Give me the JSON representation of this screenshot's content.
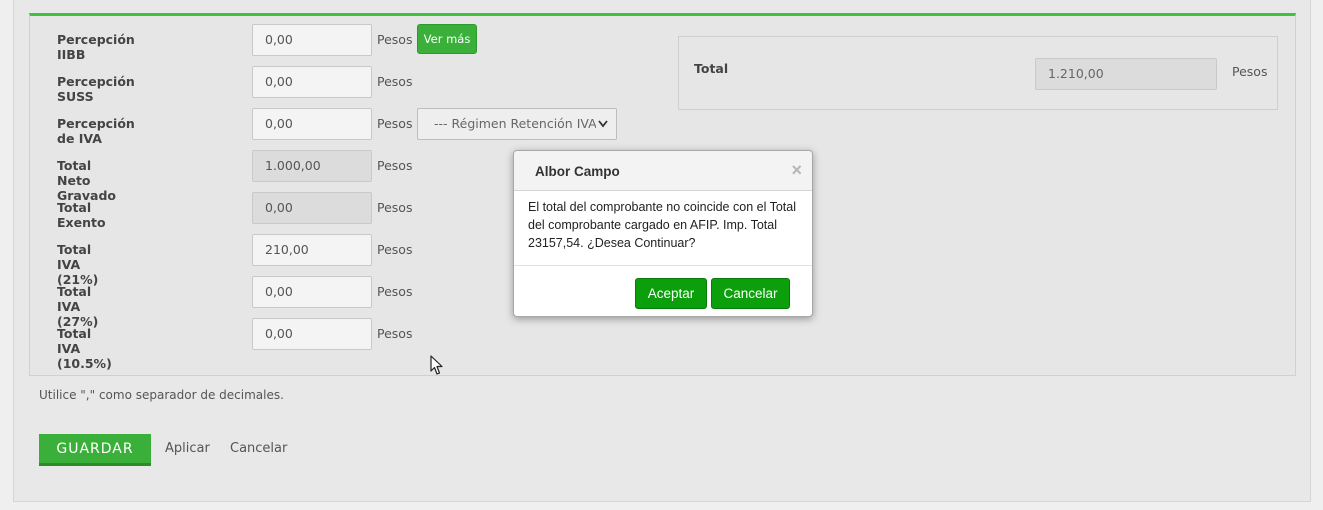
{
  "fields": [
    {
      "label": "Percepción IIBB",
      "value": "0,00",
      "unit": "Pesos",
      "readonly": false
    },
    {
      "label": "Percepción SUSS",
      "value": "0,00",
      "unit": "Pesos",
      "readonly": false
    },
    {
      "label": "Percepción de IVA",
      "value": "0,00",
      "unit": "Pesos",
      "readonly": false
    },
    {
      "label": "Total Neto Gravado",
      "value": "1.000,00",
      "unit": "Pesos",
      "readonly": true
    },
    {
      "label": "Total Exento",
      "value": "0,00",
      "unit": "Pesos",
      "readonly": true
    },
    {
      "label": "Total IVA (21%)",
      "value": "210,00",
      "unit": "Pesos",
      "readonly": false
    },
    {
      "label": "Total IVA (27%)",
      "value": "0,00",
      "unit": "Pesos",
      "readonly": false
    },
    {
      "label": "Total IVA (10.5%)",
      "value": "0,00",
      "unit": "Pesos",
      "readonly": false
    }
  ],
  "ver_mas_label": "Ver más",
  "regimen_select": {
    "selected": "--- Régimen Retención IVA"
  },
  "total": {
    "label": "Total",
    "value": "1.210,00",
    "unit": "Pesos"
  },
  "hint": "Utilice \",\" como separador de decimales.",
  "actions": {
    "guardar": "GUARDAR",
    "aplicar": "Aplicar",
    "cancelar": "Cancelar"
  },
  "dialog": {
    "title": "Albor Campo",
    "close": "×",
    "message": "El total del comprobante no coincide con el Total del comprobante cargado en AFIP. Imp. Total 23157,54. ¿Desea Continuar?",
    "accept": "Aceptar",
    "cancel": "Cancelar"
  },
  "colors": {
    "accent": "#3ab03a",
    "dialog_button": "#0c9f0c",
    "panel_top_border": "#3cc43c"
  }
}
